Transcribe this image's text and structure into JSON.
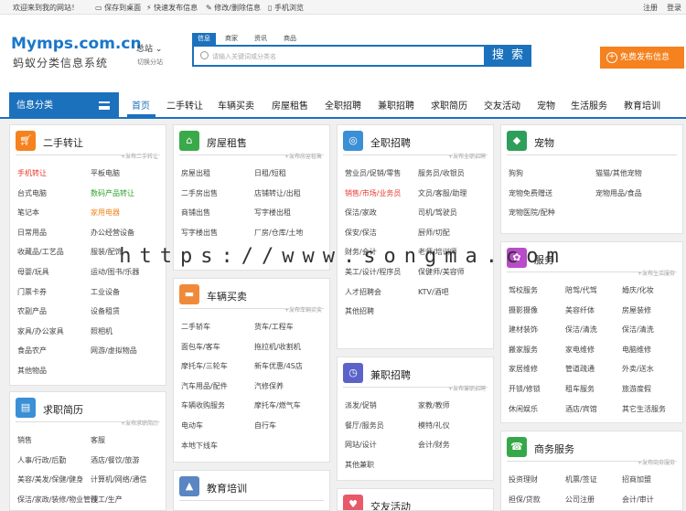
{
  "topbar": {
    "welcome": "欢迎来到我的网站！",
    "save_desktop": "保存到桌面",
    "quick_post": "快速发布信息",
    "edit_delete": "修改/删除信息",
    "mobile": "手机浏览",
    "register": "注册",
    "login": "登录"
  },
  "brand": {
    "logo": "Mymps.com.cn",
    "slogan": "蚂蚁分类信息系统",
    "city": "总站",
    "city_switch": "切换分站"
  },
  "search": {
    "tabs": [
      "信息",
      "商家",
      "资讯",
      "商品"
    ],
    "active_tab": "信息",
    "placeholder": "请输入关键词或分类名",
    "button": "搜 索"
  },
  "publish_button": "免费发布信息",
  "category_button": "信息分类",
  "nav": [
    "首页",
    "二手转让",
    "车辆买卖",
    "房屋租售",
    "全职招聘",
    "兼职招聘",
    "求职简历",
    "交友活动",
    "宠物",
    "生活服务",
    "教育培训"
  ],
  "colors": {
    "brand": "#1c71bc",
    "accent_orange": "#f5821f",
    "red_item": "#e83a2d",
    "green_item": "#2ca32c"
  },
  "cards": {
    "ershou": {
      "icon": "cart-icon",
      "title": "二手转让",
      "more": "+发布二手转让",
      "items": [
        {
          "t": "手机转让",
          "c": "r"
        },
        {
          "t": "平板电脑"
        },
        {
          "t": "台式电脑"
        },
        {
          "t": "数码产品转让",
          "c": "g"
        },
        {
          "t": "笔记本"
        },
        {
          "t": "家用电器",
          "c": "o"
        },
        {
          "t": "日常用品"
        },
        {
          "t": "办公经营设备"
        },
        {
          "t": "收藏品/工艺品"
        },
        {
          "t": "服装/配饰"
        },
        {
          "t": "母婴/玩具"
        },
        {
          "t": "运动/图书/乐器"
        },
        {
          "t": "门票卡券"
        },
        {
          "t": "工业设备"
        },
        {
          "t": "农副产品"
        },
        {
          "t": "设备租赁"
        },
        {
          "t": "家具/办公家具"
        },
        {
          "t": "照相机"
        },
        {
          "t": "食品农产"
        },
        {
          "t": "网游/虚拟物品"
        },
        {
          "t": "其他物品"
        }
      ]
    },
    "qiuzhi": {
      "icon": "resume-icon",
      "title": "求职简历",
      "more": "+发布求职简历",
      "items": [
        {
          "t": "销售"
        },
        {
          "t": "客服"
        },
        {
          "t": "人事/行政/后勤"
        },
        {
          "t": "酒店/餐饮/旅游"
        },
        {
          "t": "美容/美发/保健/健身"
        },
        {
          "t": "计算机/网络/通信"
        },
        {
          "t": "保洁/家政/装修/物业管理"
        },
        {
          "t": "技工/生产"
        }
      ]
    },
    "fangwu": {
      "icon": "house-icon",
      "title": "房屋租售",
      "more": "+发布房屋租售",
      "items": [
        {
          "t": "房屋出租"
        },
        {
          "t": "日租/短租"
        },
        {
          "t": "二手房出售"
        },
        {
          "t": "店铺转让/出租"
        },
        {
          "t": "商铺出售"
        },
        {
          "t": "写字楼出租"
        },
        {
          "t": "写字楼出售"
        },
        {
          "t": "厂房/仓库/土地"
        }
      ]
    },
    "cheliang": {
      "icon": "car-icon",
      "title": "车辆买卖",
      "more": "+发布车辆买卖",
      "items": [
        {
          "t": "二手轿车"
        },
        {
          "t": "货车/工程车"
        },
        {
          "t": "面包车/客车"
        },
        {
          "t": "拖拉机/收割机"
        },
        {
          "t": "摩托车/三轮车"
        },
        {
          "t": "新车优惠/4S店"
        },
        {
          "t": "汽车用品/配件"
        },
        {
          "t": "汽修保养"
        },
        {
          "t": "车辆收购服务"
        },
        {
          "t": "摩托车/燃气车"
        },
        {
          "t": "电动车"
        },
        {
          "t": "自行车"
        },
        {
          "t": "本地下线车"
        }
      ]
    },
    "jiaoyu": {
      "icon": "graduation-cap-icon",
      "title": "教育培训"
    },
    "quanzhi": {
      "icon": "person-search-icon",
      "title": "全职招聘",
      "more": "+发布全职招聘",
      "items": [
        {
          "t": "营业员/促销/零售"
        },
        {
          "t": "服务员/收银员"
        },
        {
          "t": "销售/市场/业务员",
          "c": "r"
        },
        {
          "t": "文员/客服/助理"
        },
        {
          "t": "保洁/家政"
        },
        {
          "t": "司机/驾驶员"
        },
        {
          "t": "保安/保洁"
        },
        {
          "t": "厨师/切配"
        },
        {
          "t": "财务/会计"
        },
        {
          "t": "老师/培训师"
        },
        {
          "t": "美工/设计/程序员"
        },
        {
          "t": "保健师/美容师"
        },
        {
          "t": "人才招聘会"
        },
        {
          "t": "KTV/酒吧"
        },
        {
          "t": "其他招聘"
        }
      ]
    },
    "jianzhi": {
      "icon": "clock-icon",
      "title": "兼职招聘",
      "more": "+发布兼职招聘",
      "items": [
        {
          "t": "派发/促销"
        },
        {
          "t": "家教/教师"
        },
        {
          "t": "餐厅/服务员"
        },
        {
          "t": "模特/礼仪"
        },
        {
          "t": "网站/设计"
        },
        {
          "t": "会计/财务"
        },
        {
          "t": "其他兼职"
        }
      ]
    },
    "jiaoyou": {
      "icon": "friends-icon",
      "title": "交友活动"
    },
    "chongwu": {
      "icon": "pet-dog-icon",
      "title": "宠物",
      "items": [
        {
          "t": "狗狗"
        },
        {
          "t": "猫猫/其他宠物"
        },
        {
          "t": "宠物免费赠送"
        },
        {
          "t": "宠物用品/食品"
        },
        {
          "t": "宠物医院/配种"
        }
      ]
    },
    "shenghuo": {
      "icon": "service-icon",
      "title": "服务",
      "more": "+发布生活服务",
      "items": [
        {
          "t": "驾校服务"
        },
        {
          "t": "陪驾/代驾"
        },
        {
          "t": "婚庆/化妆"
        },
        {
          "t": "摄影摄像"
        },
        {
          "t": "美容纤体"
        },
        {
          "t": "房屋装修"
        },
        {
          "t": "建材装饰"
        },
        {
          "t": "保洁/清洗"
        },
        {
          "t": "保洁/清洗"
        },
        {
          "t": "搬家服务"
        },
        {
          "t": "家电维修"
        },
        {
          "t": "电脑维修"
        },
        {
          "t": "家居维修"
        },
        {
          "t": "管道疏通"
        },
        {
          "t": "外卖/送水"
        },
        {
          "t": "开锁/修锁"
        },
        {
          "t": "租车服务"
        },
        {
          "t": "旅游度假"
        },
        {
          "t": "休闲娱乐"
        },
        {
          "t": "酒店/宾馆"
        },
        {
          "t": "其它生活服务"
        }
      ]
    },
    "shangwu": {
      "icon": "phone-icon",
      "title": "商务服务",
      "more": "+发布商务服务",
      "items": [
        {
          "t": "投资理财"
        },
        {
          "t": "机票/签证"
        },
        {
          "t": "招商加盟"
        },
        {
          "t": "担保/贷款"
        },
        {
          "t": "公司注册"
        },
        {
          "t": "会计/审计"
        }
      ]
    }
  },
  "watermark": "https://www.songma.com"
}
